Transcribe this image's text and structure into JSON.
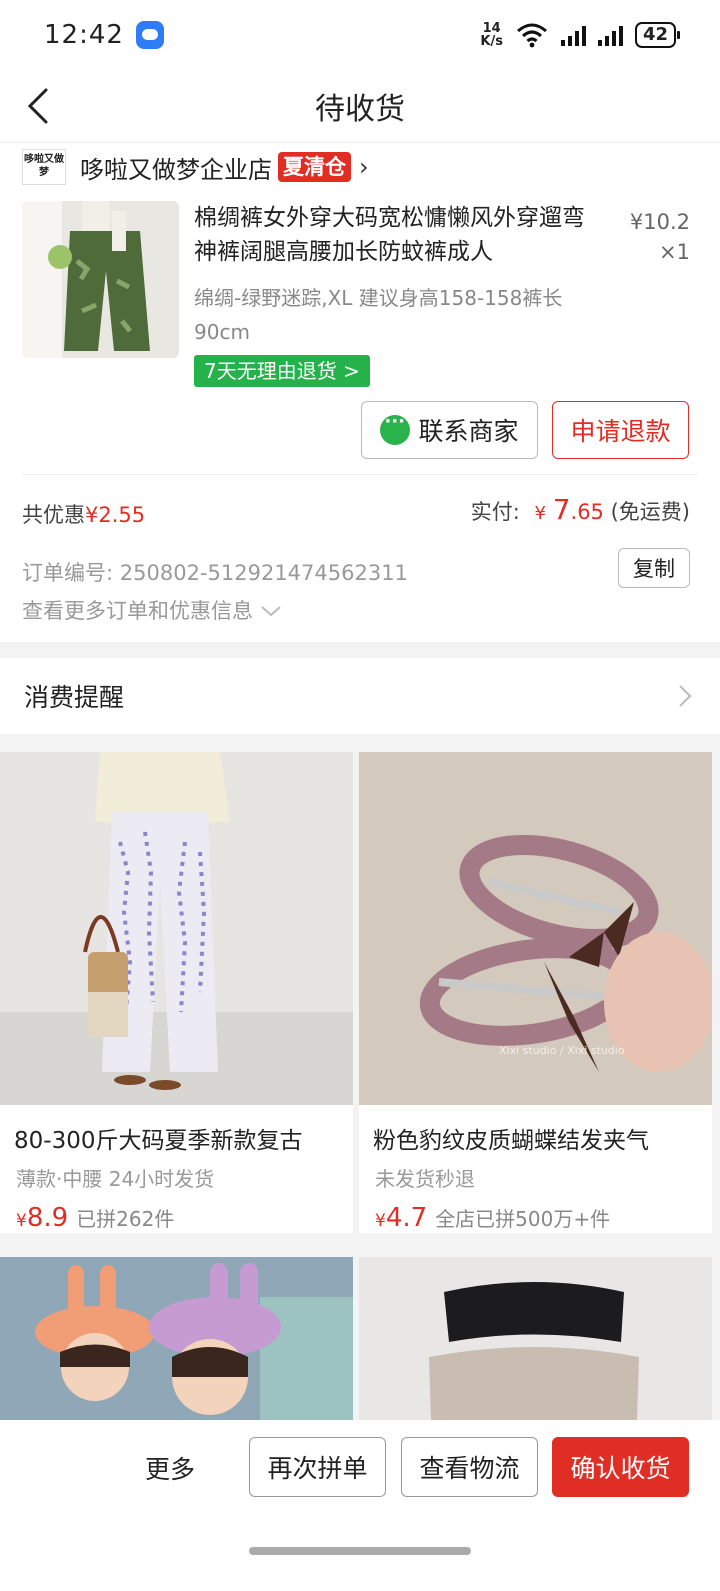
{
  "status_bar": {
    "time": "12:42",
    "net_speed_top": "14",
    "net_speed_unit": "K/s",
    "battery": "42"
  },
  "nav": {
    "title": "待收货"
  },
  "shop": {
    "logo_text": "哆啦又做梦",
    "name": "哆啦又做梦企业店",
    "tag": "夏清仓"
  },
  "product": {
    "title": "棉绸裤女外穿大码宽松慵懒风外穿遛弯神裤阔腿高腰加长防蚊裤成人",
    "price": "¥10.2",
    "qty": "×1",
    "spec": "绵绸-绿野迷踪,XL 建议身高158-158裤长90cm",
    "return_tag": "7天无理由退货 >",
    "contact_label": "联系商家",
    "refund_label": "申请退款"
  },
  "summary": {
    "discount_label": "共优惠",
    "discount_value": "¥2.55",
    "paid_label": "实付:",
    "paid_currency": "¥",
    "paid_int": "7",
    "paid_dec": ".65",
    "shipping": "(免运费)",
    "order_no_label": "订单编号:",
    "order_no": "250802-512921474562311",
    "copy_label": "复制",
    "more_info": "查看更多订单和优惠信息"
  },
  "reminder": {
    "label": "消费提醒"
  },
  "recommend": [
    {
      "name": "80-300斤大码夏季新款复古",
      "sub": "薄款·中腰 24小时发货",
      "currency": "¥",
      "price": "8.9",
      "sold": "已拼262件"
    },
    {
      "name": "粉色豹纹皮质蝴蝶结发夹气",
      "sub": "未发货秒退",
      "currency": "¥",
      "price": "4.7",
      "sold": "全店已拼500万+件",
      "watermark": "Xixi studio / Xixi studio"
    }
  ],
  "bottom_bar": {
    "more": "更多",
    "reorder": "再次拼单",
    "logistics": "查看物流",
    "confirm": "确认收货"
  },
  "colors": {
    "accent": "#e02e24",
    "green": "#26b24a"
  }
}
